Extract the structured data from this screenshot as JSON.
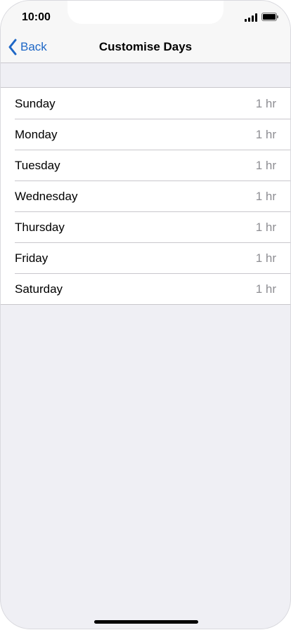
{
  "status_bar": {
    "time": "10:00",
    "icons": [
      "signal-icon",
      "battery-icon"
    ]
  },
  "nav": {
    "back_label": "Back",
    "back_icon": "chevron-left-icon",
    "title": "Customise Days"
  },
  "days": [
    {
      "label": "Sunday",
      "value": "1 hr"
    },
    {
      "label": "Monday",
      "value": "1 hr"
    },
    {
      "label": "Tuesday",
      "value": "1 hr"
    },
    {
      "label": "Wednesday",
      "value": "1 hr"
    },
    {
      "label": "Thursday",
      "value": "1 hr"
    },
    {
      "label": "Friday",
      "value": "1 hr"
    },
    {
      "label": "Saturday",
      "value": "1 hr"
    }
  ],
  "colors": {
    "accent": "#1e67c6",
    "background": "#efeff4",
    "secondary_text": "#8e8e93",
    "separator": "#c8c7cc"
  }
}
